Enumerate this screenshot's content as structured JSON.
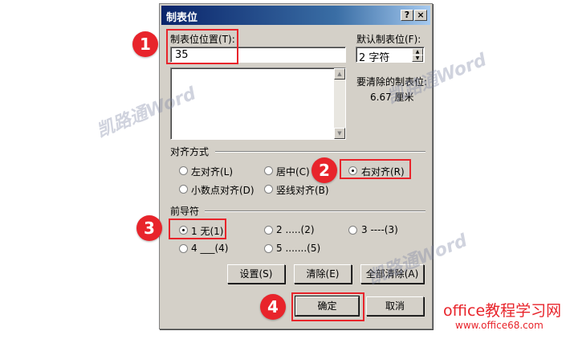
{
  "dialog": {
    "title": "制表位",
    "help_btn": "?",
    "close_btn": "×",
    "tab_pos_label": "制表位位置(T):",
    "tab_pos_value": "35",
    "default_tab_label": "默认制表位(F):",
    "default_tab_value": "2 字符",
    "clear_label": "要清除的制表位:",
    "clear_value": "6.67 厘米",
    "align_group": "对齐方式",
    "align_left": "左对齐(L)",
    "align_center": "居中(C)",
    "align_right": "右对齐(R)",
    "align_decimal": "小数点对齐(D)",
    "align_bar": "竖线对齐(B)",
    "leader_group": "前导符",
    "leader_1": "1 无(1)",
    "leader_2": "2 .....(2)",
    "leader_3": "3 ----(3)",
    "leader_4": "4 ___(4)",
    "leader_5": "5 .......(5)",
    "set_btn": "设置(S)",
    "clear_btn": "清除(E)",
    "clear_all_btn": "全部清除(A)",
    "ok_btn": "确定",
    "cancel_btn": "取消"
  },
  "annotations": {
    "badge1": "1",
    "badge2": "2",
    "badge3": "3",
    "badge4": "4"
  },
  "watermark": "凯路通Word",
  "brand": {
    "line1": "office教程学习网",
    "line2": "www.office68.com"
  },
  "colors": {
    "accent_red": "#e8242b",
    "dialog_bg": "#d4d0c8",
    "title_blue": "#0a246a"
  }
}
